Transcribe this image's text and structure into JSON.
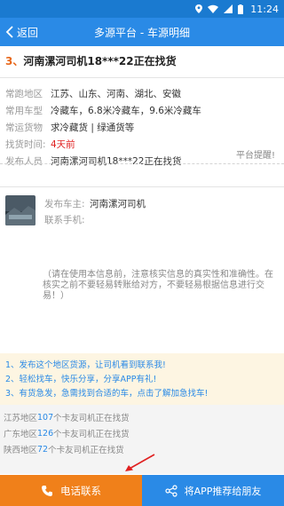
{
  "status_bar": {
    "time": "11:24"
  },
  "header": {
    "back_label": "返回",
    "title": "多源平台 - 车源明细"
  },
  "headline": {
    "index": "3、",
    "text": "河南漯河司机18***22正在找货"
  },
  "info": {
    "rows": [
      {
        "label": "常跑地区",
        "value": "江苏、山东、河南、湖北、安徽"
      },
      {
        "label": "常用车型",
        "value": "冷藏车，6.8米冷藏车，9.6米冷藏车"
      },
      {
        "label": "常运货物",
        "value": "求冷藏货 | 绿通货等"
      },
      {
        "label": "找货时间:",
        "value": "4天前"
      },
      {
        "label": "发布人员",
        "value": "河南漯河司机18***22正在找货"
      }
    ],
    "platform_note": "平台提醒!"
  },
  "publisher": {
    "owner_label": "发布车主:",
    "owner_value": "河南漯河司机",
    "phone_label": "联系手机:",
    "phone_value": ""
  },
  "disclaimer": "（请在使用本信息前，注意核实信息的真实性和准确性。在核实之前不要轻易转账给对方，不要轻易根据信息进行交易！）",
  "promo": [
    "1、发布这个地区货源，让司机看到联系我!",
    "2、轻松找车，快乐分享，分享APP有礼!",
    "3、有货急发，急需找到合适的车，点击了解加急找车!"
  ],
  "stats": [
    {
      "region": "江苏地区",
      "count": "107",
      "suffix": "个卡友司机正在找货"
    },
    {
      "region": "广东地区",
      "count": "126",
      "suffix": "个卡友司机正在找货"
    },
    {
      "region": "陕西地区",
      "count": "72",
      "suffix": "个卡友司机正在找货"
    }
  ],
  "bottom": {
    "call_label": "电话联系",
    "share_label": "将APP推荐给朋友"
  },
  "colors": {
    "header": "#2a8ae6",
    "status": "#1a7ad0",
    "call": "#f0801a",
    "share": "#2a8ae6",
    "accent_red": "#e02020",
    "promo_bg": "#fdf5e2"
  }
}
